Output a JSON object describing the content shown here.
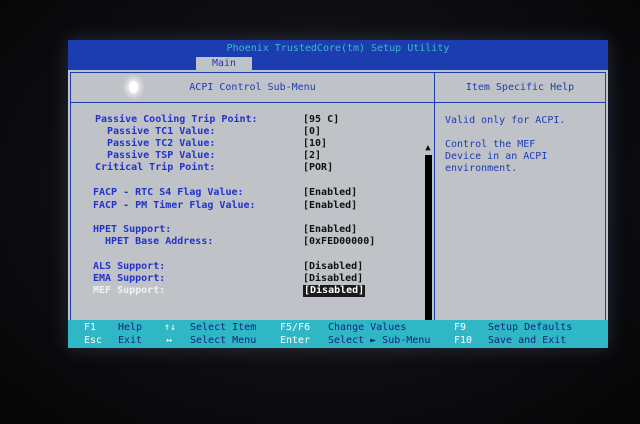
{
  "app_title": "Phoenix TrustedCore(tm) Setup Utility",
  "tabs": [
    {
      "label": "Main"
    }
  ],
  "panel": {
    "title": "ACPI Control Sub-Menu",
    "help_title": "Item Specific Help"
  },
  "settings": [
    {
      "label": "Passive Cooling Trip Point:",
      "value": "[95  C]"
    },
    {
      "label": "Passive TC1 Value:",
      "value": "[0]"
    },
    {
      "label": "Passive TC2 Value:",
      "value": "[10]"
    },
    {
      "label": "Passive TSP Value:",
      "value": "[2]"
    },
    {
      "label": "Critical Trip Point:",
      "value": "[POR]"
    },
    {
      "label": "FACP - RTC S4 Flag Value:",
      "value": "[Enabled]"
    },
    {
      "label": "FACP - PM Timer Flag Value:",
      "value": "[Enabled]"
    },
    {
      "label": "HPET Support:",
      "value": "[Enabled]"
    },
    {
      "label": "HPET Base Address:",
      "value": "[0xFED00000]"
    },
    {
      "label": "ALS Support:",
      "value": "[Disabled]"
    },
    {
      "label": "EMA Support:",
      "value": "[Disabled]"
    },
    {
      "label": "MEF Support:",
      "value": "[Disabled]",
      "selected": true
    }
  ],
  "help": {
    "line1": "Valid only for ACPI.",
    "line2": "Control the MEF\nDevice in an ACPI\nenvironment."
  },
  "footer": {
    "row1": [
      {
        "key": "F1",
        "desc": "Help"
      },
      {
        "key": "↑↓",
        "desc": "Select Item"
      },
      {
        "key": "F5/F6",
        "desc": "Change Values"
      },
      {
        "key": "F9",
        "desc": "Setup Defaults"
      }
    ],
    "row2": [
      {
        "key": "Esc",
        "desc": "Exit"
      },
      {
        "key": "↔",
        "desc": "Select Menu"
      },
      {
        "key": "Enter",
        "desc": "Select ► Sub-Menu"
      },
      {
        "key": "F10",
        "desc": "Save and Exit"
      }
    ]
  },
  "colors": {
    "bios_blue": "#1c3db0",
    "bios_gray": "#bfc2c7",
    "footer_cyan": "#2fb7c6"
  }
}
